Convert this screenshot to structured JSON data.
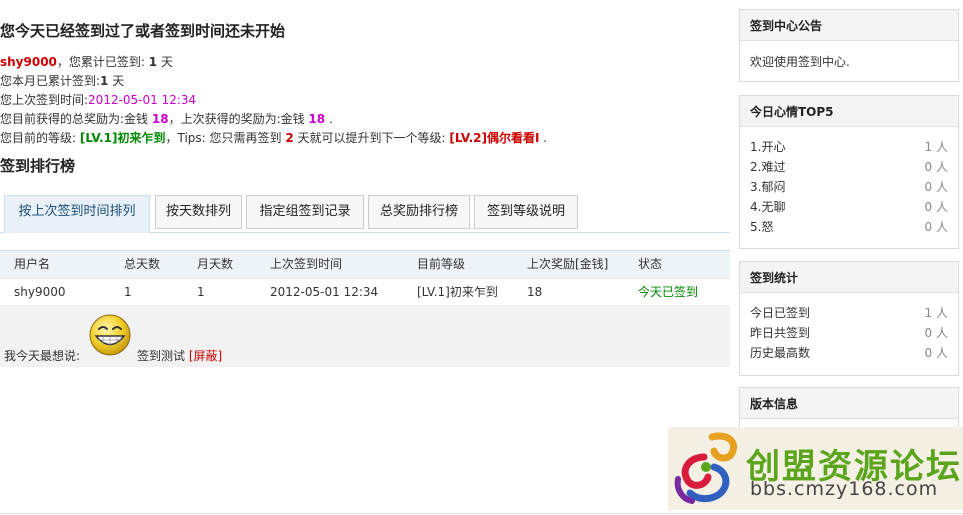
{
  "status": {
    "title": "您今天已经签到过了或者签到时间还未开始",
    "username": "shy9000",
    "line1_mid": "，您累计已签到: ",
    "total_days": "1",
    "line1_end": " 天",
    "line2_pre": "您本月已累计签到:",
    "month_days": "1",
    "line2_end": " 天",
    "line3_pre": "您上次签到时间:",
    "last_time": "2012-05-01 12:34",
    "line4_pre": "您目前获得的总奖励为:金钱 ",
    "total_reward": "18",
    "line4_mid": "，上次获得的奖励为:金钱 ",
    "last_reward": "18",
    "line4_end": " .",
    "line5_pre": "您目前的等级: ",
    "level": "[LV.1]初来乍到",
    "line5_mid": "，Tips: 您只需再签到 ",
    "days_needed": "2",
    "line5_mid2": " 天就可以提升到下一个等级: ",
    "next_level": "[LV.2]偶尔看看I",
    "line5_end": " ."
  },
  "ranking": {
    "title": "签到排行榜",
    "tabs": [
      {
        "label": "按上次签到时间排列"
      },
      {
        "label": "按天数排列"
      },
      {
        "label": "指定组签到记录"
      },
      {
        "label": "总奖励排行榜"
      },
      {
        "label": "签到等级说明"
      }
    ],
    "headers": [
      "用户名",
      "总天数",
      "月天数",
      "上次签到时间",
      "目前等级",
      "上次奖励[金钱]",
      "状态"
    ],
    "rows": [
      [
        "shy9000",
        "1",
        "1",
        "2012-05-01 12:34",
        "[LV.1]初来乍到",
        "18",
        "今天已签到"
      ]
    ]
  },
  "mood": {
    "label": "我今天最想说:",
    "text": "签到测试",
    "block_link": "[屏蔽]",
    "icon": "grinning-smiley-icon"
  },
  "sidebar": {
    "notice": {
      "title": "签到中心公告",
      "text": "欢迎使用签到中心."
    },
    "top5": {
      "title": "今日心情TOP5",
      "items": [
        {
          "label": "1.开心",
          "value": "1 人"
        },
        {
          "label": "2.难过",
          "value": "0 人"
        },
        {
          "label": "3.郁闷",
          "value": "0 人"
        },
        {
          "label": "4.无聊",
          "value": "0 人"
        },
        {
          "label": "5.怒",
          "value": "0 人"
        }
      ]
    },
    "stats": {
      "title": "签到统计",
      "items": [
        {
          "label": "今日已签到",
          "value": "1 人"
        },
        {
          "label": "昨日共签到",
          "value": "0 人"
        },
        {
          "label": "历史最高数",
          "value": "0 人"
        }
      ]
    },
    "version": {
      "title": "版本信息"
    }
  },
  "watermark": {
    "title": "创盟资源论坛",
    "url": "bbs.cmzy168.com"
  }
}
